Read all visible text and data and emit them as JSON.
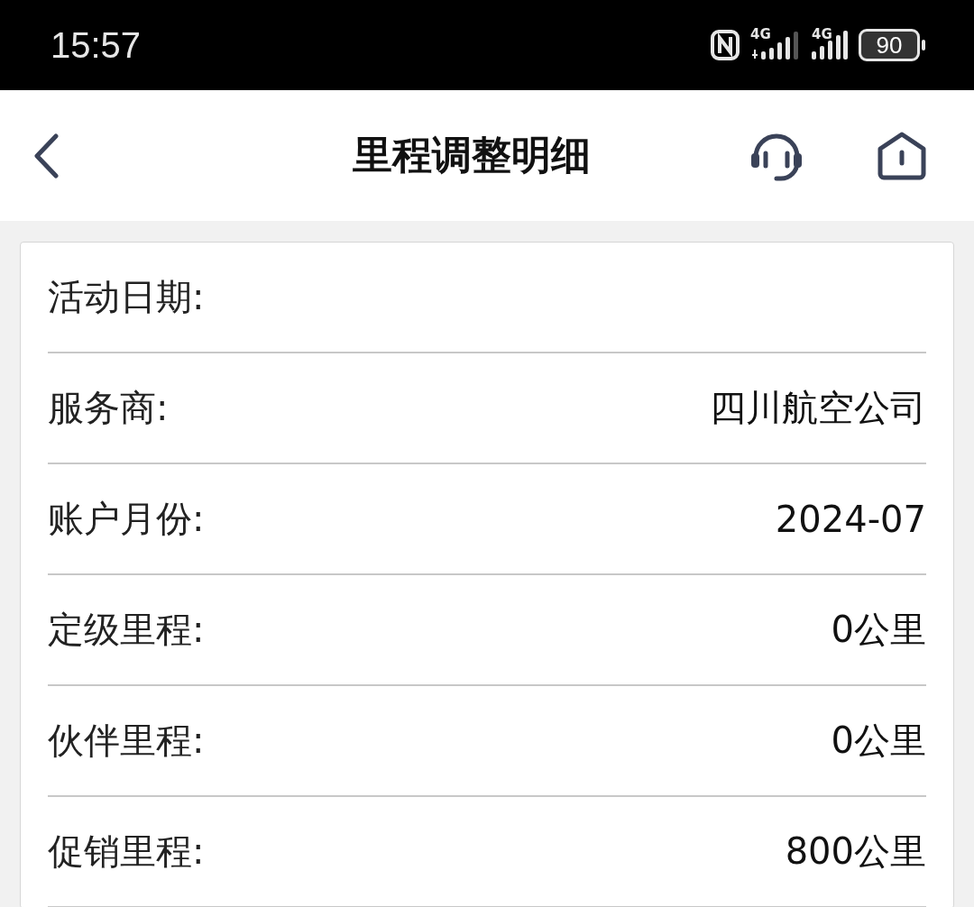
{
  "status_bar": {
    "time": "15:57",
    "network_1": "4G",
    "network_2": "4G",
    "battery": "90"
  },
  "header": {
    "title": "里程调整明细"
  },
  "details": [
    {
      "label": "活动日期:"
    },
    {
      "label": "服务商:",
      "value": "四川航空公司"
    },
    {
      "label": "账户月份:",
      "value": "2024-07"
    },
    {
      "label": "定级里程:",
      "value": "0公里"
    },
    {
      "label": "伙伴里程:",
      "value": "0公里"
    },
    {
      "label": "促销里程:",
      "value": "800公里"
    }
  ]
}
